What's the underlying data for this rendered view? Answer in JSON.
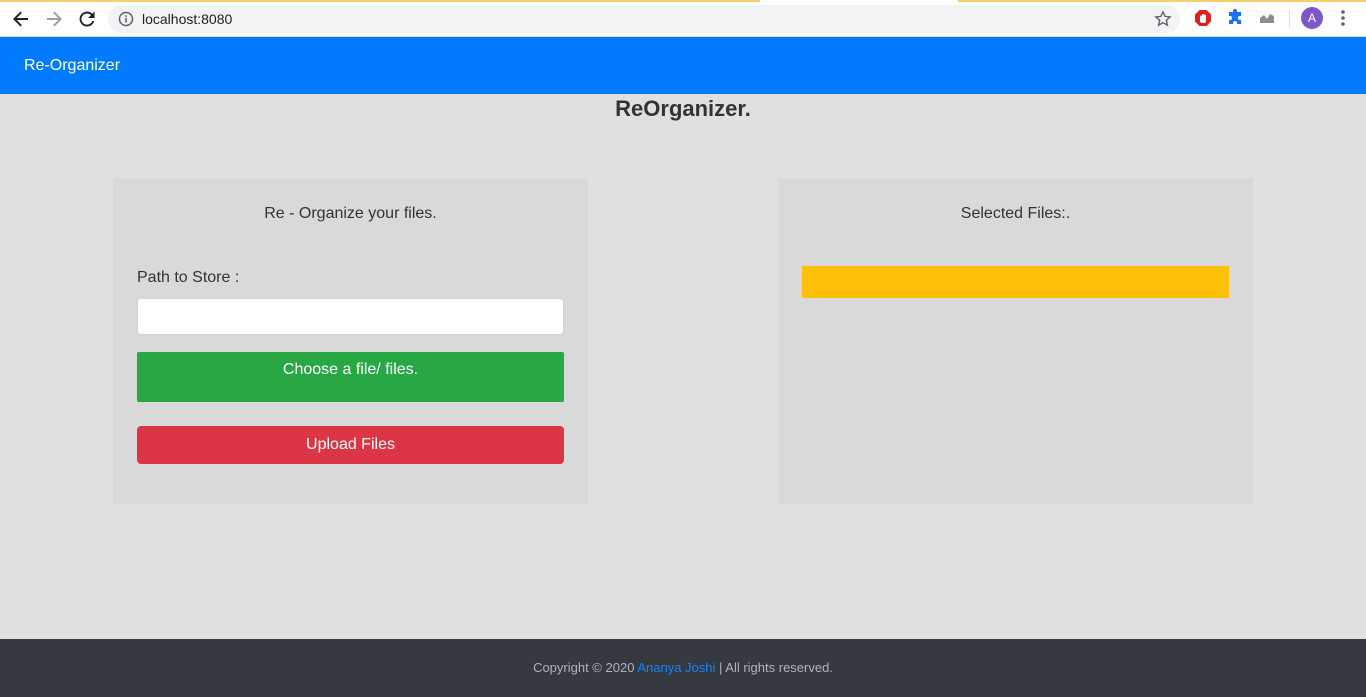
{
  "browser": {
    "url": "localhost:8080",
    "avatar_letter": "A",
    "icons": [
      "back-icon",
      "forward-icon",
      "reload-icon",
      "info-icon",
      "star-icon",
      "adblock-icon",
      "extensions-icon",
      "analytics-icon",
      "menu-icon"
    ]
  },
  "navbar": {
    "brand": "Re-Organizer",
    "color": "#007bff"
  },
  "page": {
    "title": "ReOrganizer."
  },
  "left_card": {
    "heading": "Re - Organize your files.",
    "path_label": "Path to Store :",
    "path_value": "",
    "path_placeholder": "",
    "choose_label": "Choose a file/ files.",
    "upload_label": "Upload Files"
  },
  "right_card": {
    "heading": "Selected Files:."
  },
  "footer": {
    "prefix": "Copyright © 2020 ",
    "author": "Ananya Joshi",
    "suffix": " | All rights reserved."
  },
  "colors": {
    "success": "#28a745",
    "danger": "#dc3545",
    "warning": "#ffc107",
    "footer_bg": "#343a40"
  }
}
